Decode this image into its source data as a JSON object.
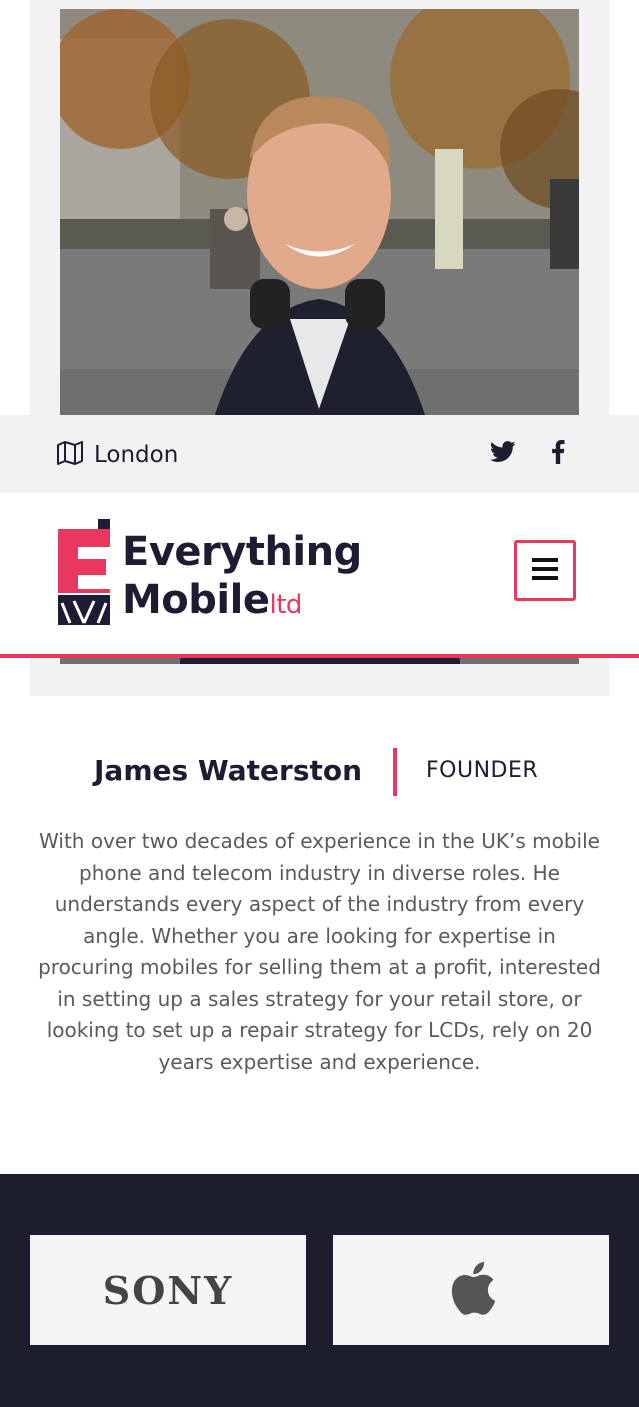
{
  "location": {
    "icon": "map-icon",
    "text": "London"
  },
  "social": [
    {
      "name": "twitter",
      "icon": "twitter-icon"
    },
    {
      "name": "facebook",
      "icon": "facebook-icon"
    }
  ],
  "logo": {
    "line1": "Everything",
    "line2": "Mobile",
    "suffix": "ltd"
  },
  "menu": {
    "icon": "hamburger-icon"
  },
  "profile": {
    "name": "James Waterston",
    "role": "FOUNDER",
    "bio": "With over two decades of experience in the UK’s mobile phone and telecom industry in diverse roles. He understands every aspect of the industry from every angle. Whether you are looking for expertise in procuring mobiles for selling them at a profit, interested in setting up a sales strategy for your retail store, or looking to set up a repair strategy for LCDs, rely on 20 years expertise and experience."
  },
  "brands": [
    {
      "name": "SONY",
      "icon": "sony-logo"
    },
    {
      "name": "Apple",
      "icon": "apple-icon"
    }
  ],
  "colors": {
    "accent": "#e8385f",
    "navy": "#1c1d33",
    "footer": "#1c1d2d"
  }
}
